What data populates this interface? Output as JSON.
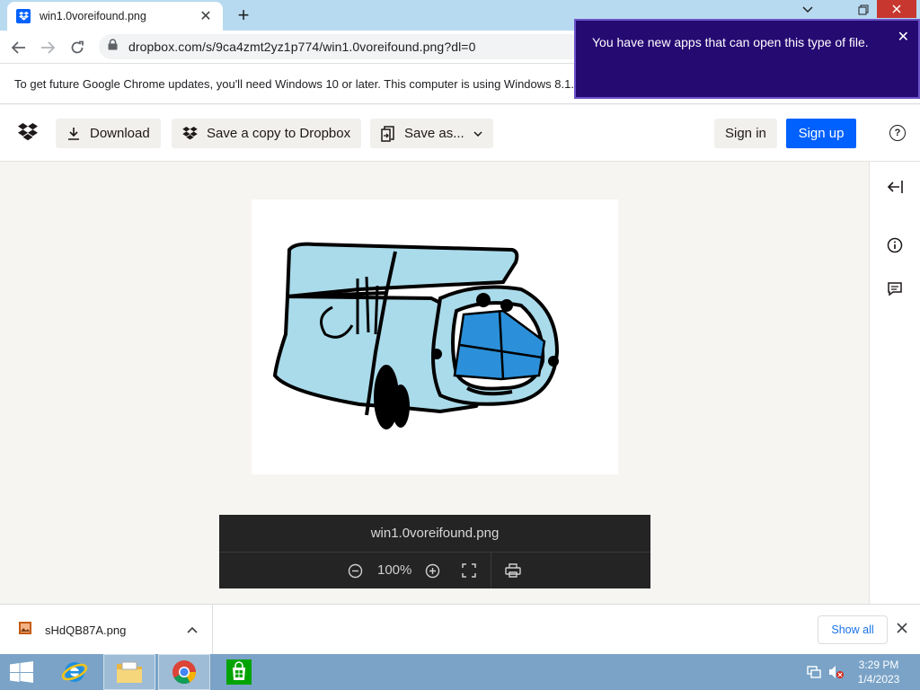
{
  "browser": {
    "tab_title": "win1.0voreifound.png",
    "url": "dropbox.com/s/9ca4zmt2yz1p774/win1.0voreifound.png?dl=0"
  },
  "infobar": {
    "message": "To get future Google Chrome updates, you'll need Windows 10 or later. This computer is using Windows 8.1."
  },
  "notification": {
    "message": "You have new apps that can open this type of file."
  },
  "dropbox_header": {
    "download_label": "Download",
    "save_copy_label": "Save a copy to Dropbox",
    "save_as_label": "Save as...",
    "sign_in_label": "Sign in",
    "sign_up_label": "Sign up",
    "accent_color": "#0061fe"
  },
  "viewer": {
    "file_name": "win1.0voreifound.png",
    "zoom": "100%"
  },
  "download_shelf": {
    "file_name": "sHdQB87A.png",
    "show_all_label": "Show all"
  },
  "taskbar": {
    "time": "3:29 PM",
    "date": "1/4/2023"
  }
}
